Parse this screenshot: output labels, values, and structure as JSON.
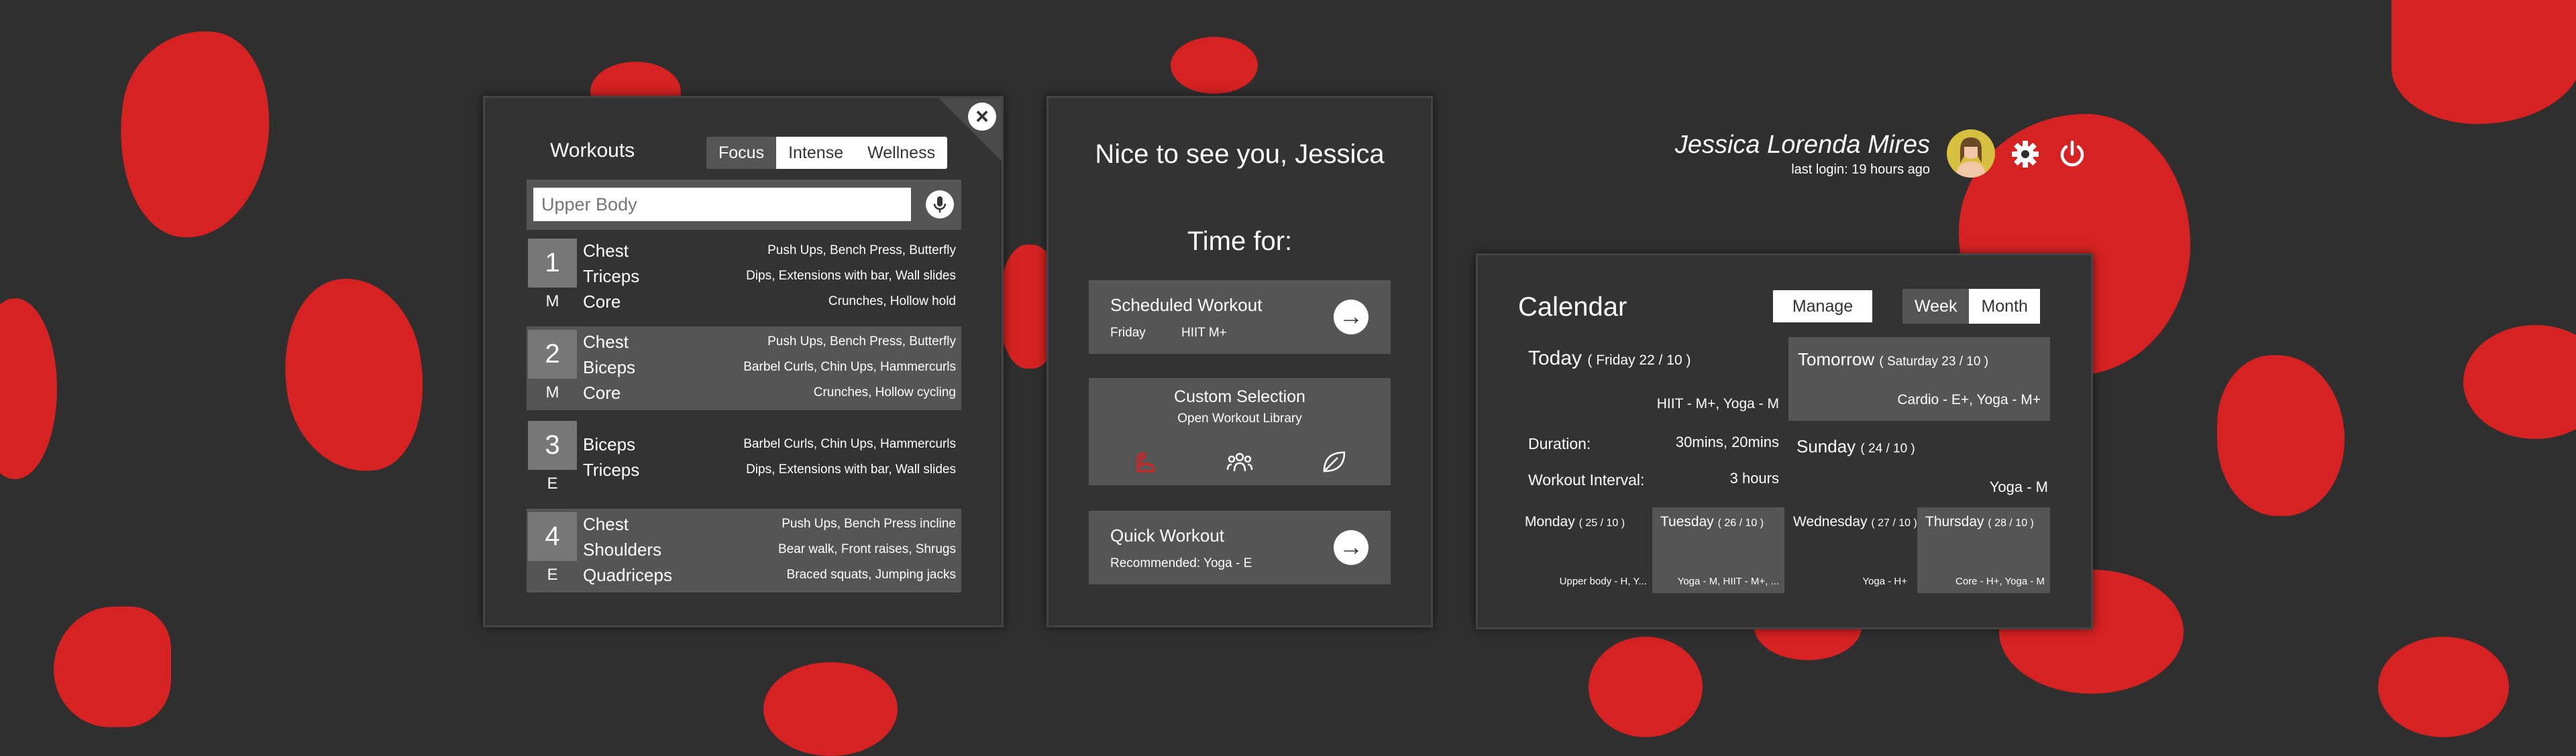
{
  "colors": {
    "background": "#2f2f2f",
    "accent": "#d62222",
    "panel": "#333333",
    "panel_row": "#555555"
  },
  "workouts": {
    "title": "Workouts",
    "tabs": [
      {
        "label": "Focus",
        "active": true
      },
      {
        "label": "Intense",
        "active": false
      },
      {
        "label": "Wellness",
        "active": false
      }
    ],
    "search": {
      "placeholder": "Upper Body",
      "value": ""
    },
    "items": [
      {
        "number": "1",
        "level": "M",
        "rows": [
          {
            "muscle": "Chest",
            "exercises": "Push Ups, Bench Press, Butterfly"
          },
          {
            "muscle": "Triceps",
            "exercises": "Dips, Extensions with bar, Wall slides"
          },
          {
            "muscle": "Core",
            "exercises": "Crunches, Hollow hold"
          }
        ]
      },
      {
        "number": "2",
        "level": "M",
        "rows": [
          {
            "muscle": "Chest",
            "exercises": "Push Ups, Bench Press, Butterfly"
          },
          {
            "muscle": "Biceps",
            "exercises": "Barbel Curls, Chin Ups, Hammercurls"
          },
          {
            "muscle": "Core",
            "exercises": "Crunches, Hollow cycling"
          }
        ]
      },
      {
        "number": "3",
        "level": "E",
        "rows": [
          {
            "muscle": "Biceps",
            "exercises": "Barbel Curls, Chin Ups, Hammercurls"
          },
          {
            "muscle": "Triceps",
            "exercises": "Dips, Extensions with bar, Wall slides"
          }
        ]
      },
      {
        "number": "4",
        "level": "E",
        "rows": [
          {
            "muscle": "Chest",
            "exercises": "Push Ups, Bench Press incline"
          },
          {
            "muscle": "Shoulders",
            "exercises": "Bear walk, Front raises, Shrugs"
          },
          {
            "muscle": "Quadriceps",
            "exercises": "Braced squats, Jumping jacks"
          }
        ]
      }
    ]
  },
  "welcome": {
    "greeting": "Nice to see you, Jessica",
    "time_for": "Time for:",
    "scheduled": {
      "title": "Scheduled Workout",
      "day": "Friday",
      "workout": "HIIT M+"
    },
    "custom": {
      "title": "Custom Selection",
      "subtitle": "Open Workout Library",
      "icons": [
        "flexed-arm-icon",
        "group-icon",
        "leaf-icon"
      ]
    },
    "quick": {
      "title": "Quick Workout",
      "subtitle": "Recommended: Yoga - E"
    }
  },
  "user": {
    "name": "Jessica Lorenda Mires",
    "last_login": "last login:  19 hours ago"
  },
  "calendar": {
    "title": "Calendar",
    "manage_label": "Manage",
    "view_tabs": [
      {
        "label": "Week",
        "active": true
      },
      {
        "label": "Month",
        "active": false
      }
    ],
    "today": {
      "label": "Today",
      "date": "( Friday 22 / 10 )",
      "workouts": "HIIT - M+, Yoga - M",
      "duration_label": "Duration:",
      "duration": "30mins, 20mins",
      "interval_label": "Workout Interval:",
      "interval": "3 hours"
    },
    "tomorrow": {
      "label": "Tomorrow",
      "date": "( Saturday 23 / 10 )",
      "workouts": "Cardio - E+, Yoga - M+"
    },
    "sunday": {
      "label": "Sunday",
      "date": "( 24 / 10 )",
      "workouts": "Yoga - M"
    },
    "week": [
      {
        "day": "Monday",
        "date": "( 25 / 10 )",
        "workouts": "Upper body - H, Y..."
      },
      {
        "day": "Tuesday",
        "date": "( 26 / 10 )",
        "workouts": "Yoga - M, HIIT - M+, ..."
      },
      {
        "day": "Wednesday",
        "date": "( 27 / 10 )",
        "workouts": "Yoga - H+"
      },
      {
        "day": "Thursday",
        "date": "( 28 / 10 )",
        "workouts": "Core - H+, Yoga - M"
      }
    ]
  }
}
